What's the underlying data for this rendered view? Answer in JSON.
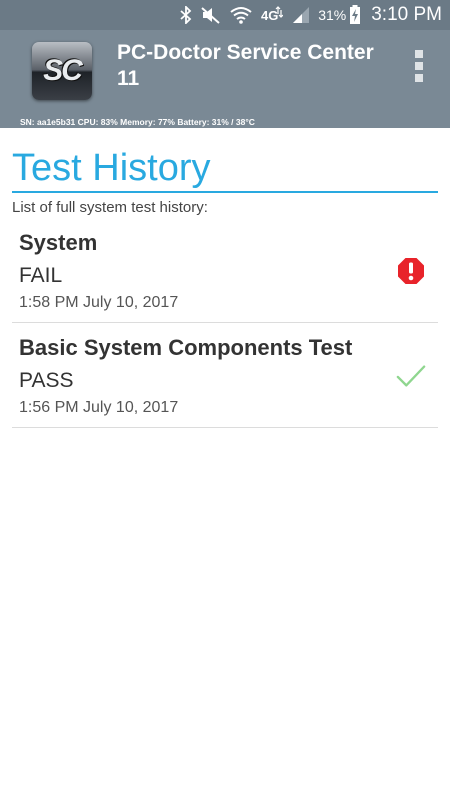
{
  "status_bar": {
    "battery_percent": "31%",
    "time": "3:10 PM",
    "network": "4G",
    "icons": [
      "bluetooth-icon",
      "mute-icon",
      "wifi-icon",
      "network-4g-icon",
      "signal-icon",
      "battery-charging-icon"
    ]
  },
  "header": {
    "logo_text": "SC",
    "title": "PC-Doctor Service Center 11",
    "device_info": "SN: aa1e5b31 CPU: 83% Memory: 77% Battery: 31% / 38°C",
    "menu_icon": "overflow-menu-icon"
  },
  "page": {
    "title": "Test History",
    "subtitle": "List of full system test history:"
  },
  "history": [
    {
      "name": "System",
      "result": "FAIL",
      "time": "1:58 PM July 10, 2017",
      "status_icon": "error-octagon-icon",
      "status_color": "#e8232a"
    },
    {
      "name": "Basic System Components Test",
      "result": "PASS",
      "time": "1:56 PM July 10, 2017",
      "status_icon": "checkmark-icon",
      "status_color": "#8fd68f"
    }
  ],
  "colors": {
    "accent": "#29a9e0",
    "header_bg": "#7a8995",
    "status_bar_bg": "#6b7a86"
  }
}
